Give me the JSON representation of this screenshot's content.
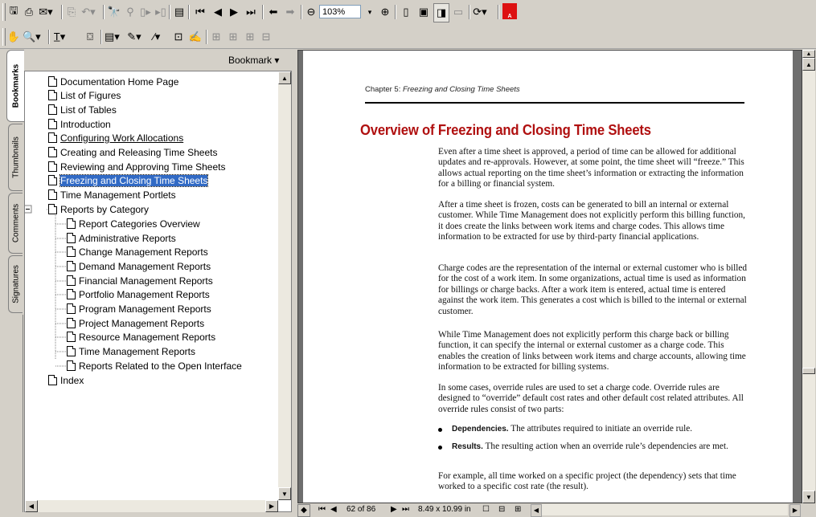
{
  "toolbar1": {
    "zoom_value": "103%"
  },
  "bookmarks_panel": {
    "menu_label": "Bookmark ▾",
    "tabs": [
      "Bookmarks",
      "Thumbnails",
      "Comments",
      "Signatures"
    ],
    "items": [
      "Documentation Home Page",
      "List of Figures",
      "List of Tables",
      "Introduction",
      "Configuring Work Allocations",
      "Creating and Releasing Time Sheets",
      "Reviewing and Approving Time Sheets",
      "Freezing and Closing Time Sheets",
      "Time Management Portlets",
      "Reports by Category",
      "Report Categories Overview",
      "Administrative Reports",
      "Change Management Reports",
      "Demand Management Reports",
      "Financial Management Reports",
      "Portfolio Management Reports",
      "Program Management Reports",
      "Project Management Reports",
      "Resource Management Reports",
      "Time Management Reports",
      "Reports Related to the Open Interface",
      "Index"
    ]
  },
  "document": {
    "running_header_prefix": "Chapter 5: ",
    "running_header_title": "Freezing and Closing Time Sheets",
    "heading": "Overview of Freezing and Closing Time Sheets",
    "paragraphs": [
      "Even after a time sheet is approved, a period of time can be allowed for additional updates and re-approvals. However, at some point, the time sheet will “freeze.” This allows actual reporting on the time sheet’s information or extracting the information for a billing or financial system.",
      "After a time sheet is frozen, costs can be generated to bill an internal or external customer. While Time Management does not explicitly perform this billing function, it does create the links between work items and charge codes. This allows time information to be extracted for use by third-party financial applications.",
      "Charge codes are the representation of the internal or external customer who is billed for the cost of a work item. In some organizations, actual time is used as information for billings or charge backs. After a work item is entered, actual time is entered against the work item. This generates a cost which is billed to the internal or external customer.",
      "While Time Management does not explicitly perform this charge back or billing function, it can specify the internal or external customer as a charge code. This enables the creation of links between work items and charge accounts, allowing time information to be extracted for billing systems.",
      "In some cases, override rules are used to set a charge code. Override rules are designed to “override” default cost rates and other default cost related attributes. All override rules consist of two parts:"
    ],
    "bullets": [
      {
        "term": "Dependencies.",
        "text": " The attributes required to initiate an override rule."
      },
      {
        "term": "Results.",
        "text": " The resulting action when an override rule’s dependencies are met."
      }
    ],
    "closing": "For example, all time worked on a specific project (the dependency) sets that time worked to a specific cost rate (the result)."
  },
  "status_bar": {
    "page_indicator": "62 of 86",
    "page_size": "8.49 x 10.99 in"
  },
  "colors": {
    "selection": "#316ac5",
    "heading": "#b01010",
    "chrome": "#d4d0c8"
  }
}
